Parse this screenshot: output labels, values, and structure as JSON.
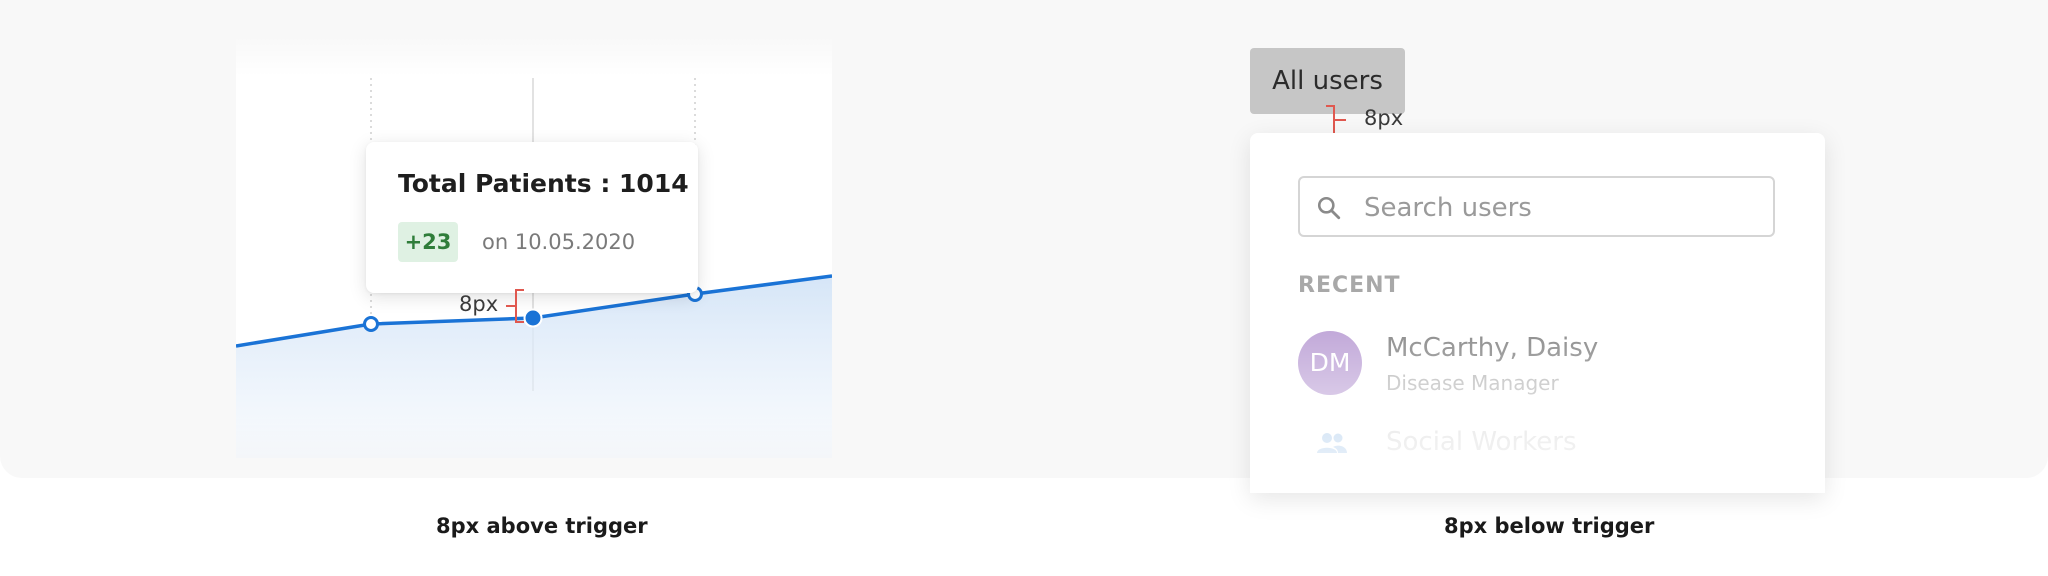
{
  "left_example": {
    "tooltip": {
      "title": "Total Patients : 1014",
      "delta": "+23",
      "date_text": "on 10.05.2020"
    },
    "spacing_label": "8px",
    "caption": "8px above trigger"
  },
  "right_example": {
    "trigger_label": "All users",
    "spacing_label": "8px",
    "search": {
      "placeholder": "Search users",
      "value": ""
    },
    "section_label": "RECENT",
    "recent_users": [
      {
        "initials": "DM",
        "name": "McCarthy, Daisy",
        "role": "Disease Manager"
      }
    ],
    "recent_groups": [
      {
        "icon": "people-icon",
        "name": "Social Workers"
      }
    ],
    "caption": "8px below trigger"
  },
  "colors": {
    "line": "#1a73d6",
    "area_fill": "#dbe9f8",
    "badge_bg": "#dff1e3",
    "badge_text": "#2f7d3a",
    "avatar_bg": "#b89bd3",
    "measure": "#e0584f",
    "trigger_bg": "#c6c6c6"
  }
}
